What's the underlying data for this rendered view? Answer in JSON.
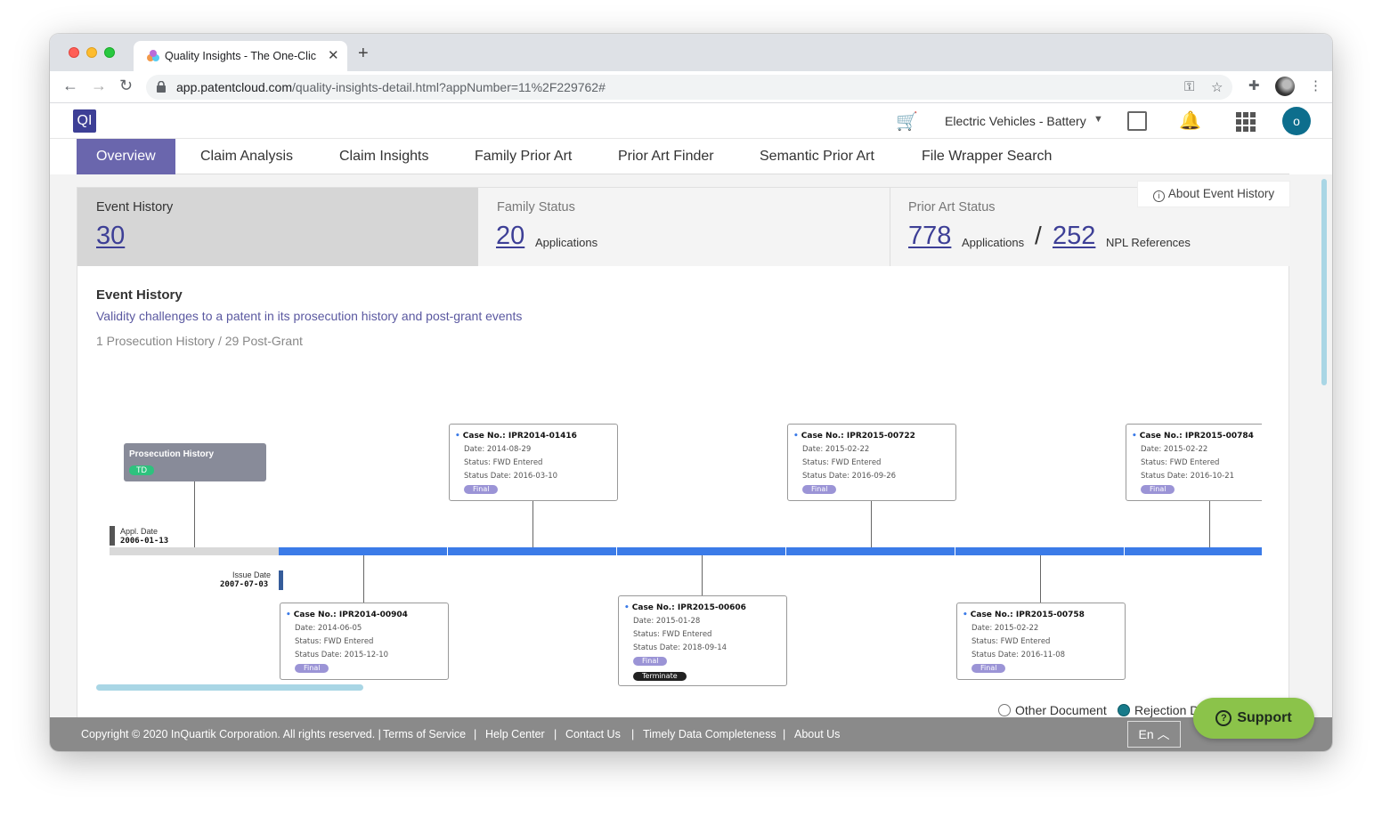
{
  "browser": {
    "tab_title": "Quality Insights - The One-Clic",
    "tab_close": "✕",
    "new_tab": "+",
    "url_host": "app.patentcloud.com",
    "url_path": "/quality-insights-detail.html?appNumber=11%2F229762#"
  },
  "header": {
    "logo": "QI",
    "workspace": "Electric Vehicles - Battery",
    "avatar_initial": "o"
  },
  "tabs": [
    "Overview",
    "Claim Analysis",
    "Claim Insights",
    "Family Prior Art",
    "Prior Art Finder",
    "Semantic Prior Art",
    "File Wrapper Search"
  ],
  "stats": {
    "event_history_label": "Event History",
    "event_history_count": "30",
    "family_status_label": "Family Status",
    "family_count": "20",
    "family_unit": "Applications",
    "prior_art_label": "Prior Art Status",
    "prior_art_apps": "778",
    "prior_art_apps_unit": "Applications",
    "slash": "/",
    "npl_count": "252",
    "npl_unit": "NPL References",
    "about_button": "About Event History"
  },
  "section": {
    "title": "Event History",
    "subtitle": "Validity challenges to a patent in its prosecution history and post-grant events",
    "meta": "1 Prosecution History  /  29 Post-Grant"
  },
  "timeline": {
    "appl_label": "Appl. Date",
    "appl_date": "2006-01-13",
    "issue_label": "Issue Date",
    "issue_date": "2007-07-03",
    "prosecution_title": "Prosecution History",
    "prosecution_badge": "TD",
    "cases": [
      {
        "no": "Case No.: IPR2014-01416",
        "date": "Date: 2014-08-29",
        "status": "Status: FWD Entered",
        "status_date": "Status Date: 2016-03-10",
        "badge": "Final"
      },
      {
        "no": "Case No.: IPR2015-00722",
        "date": "Date: 2015-02-22",
        "status": "Status: FWD Entered",
        "status_date": "Status Date: 2016-09-26",
        "badge": "Final"
      },
      {
        "no": "Case No.: IPR2015-00784",
        "date": "Date: 2015-02-22",
        "status": "Status: FWD Entered",
        "status_date": "Status Date: 2016-10-21",
        "badge": "Final"
      },
      {
        "no": "Case No.: IPR2014-00904",
        "date": "Date: 2014-06-05",
        "status": "Status: FWD Entered",
        "status_date": "Status Date: 2015-12-10",
        "badge": "Final"
      },
      {
        "no": "Case No.: IPR2015-00606",
        "date": "Date: 2015-01-28",
        "status": "Status: FWD Entered",
        "status_date": "Status Date: 2018-09-14",
        "badge": "Final",
        "badge2": "Terminate"
      },
      {
        "no": "Case No.: IPR2015-00758",
        "date": "Date: 2015-02-22",
        "status": "Status: FWD Entered",
        "status_date": "Status Date: 2016-11-08",
        "badge": "Final"
      }
    ]
  },
  "legend": {
    "other_document": "Other Document",
    "rejection": "Rejection D"
  },
  "support_label": "Support",
  "footer": {
    "copyright": "Copyright © 2020 InQuartik Corporation. All rights reserved. |",
    "terms": "Terms of Service",
    "sep": "|",
    "help": "Help Center",
    "contact": "Contact Us",
    "timely": "Timely Data Completeness",
    "about": "About Us",
    "lang": "En ︿"
  }
}
